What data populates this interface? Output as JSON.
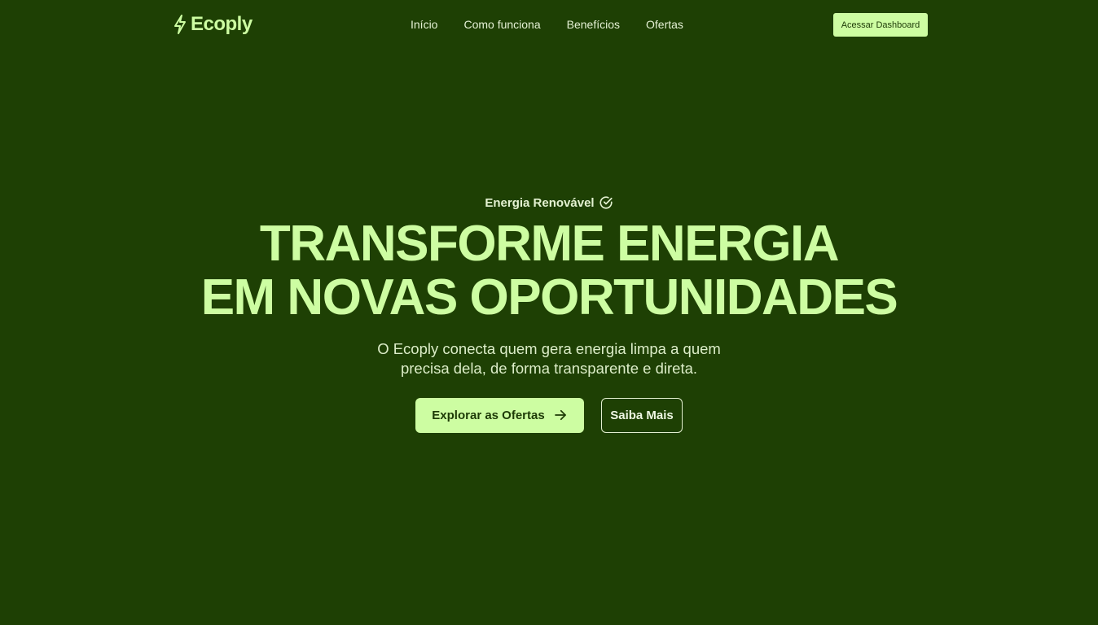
{
  "brand": {
    "name": "Ecoply",
    "logo_icon": "lightning-bolt-icon",
    "accent_color": "#cdfda2",
    "background_color": "#1e4004"
  },
  "nav": {
    "items": [
      {
        "label": "Início"
      },
      {
        "label": "Como funciona"
      },
      {
        "label": "Benefícios"
      },
      {
        "label": "Ofertas"
      }
    ],
    "dashboard_button": "Acessar Dashboard"
  },
  "hero": {
    "eyebrow": "Energia Renovável",
    "eyebrow_icon": "check-circle-icon",
    "headline_line1": "TRANSFORME ENERGIA",
    "headline_line2": "EM NOVAS OPORTUNIDADES",
    "subtitle": "O Ecoply conecta quem gera energia limpa a quem precisa dela, de forma transparente e direta.",
    "primary_button": "Explorar as Ofertas",
    "primary_button_icon": "arrow-right-icon",
    "secondary_button": "Saiba Mais"
  }
}
